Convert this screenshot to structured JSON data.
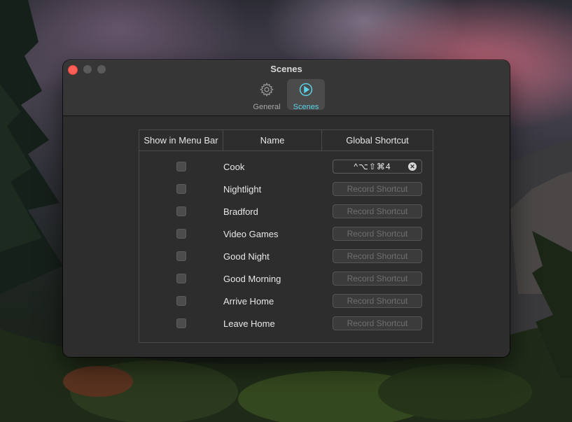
{
  "window": {
    "title": "Scenes",
    "tabs": [
      {
        "label": "General",
        "icon": "gear-icon",
        "active": false
      },
      {
        "label": "Scenes",
        "icon": "play-icon",
        "active": true
      }
    ]
  },
  "table": {
    "headers": [
      "Show in Menu Bar",
      "Name",
      "Global Shortcut"
    ],
    "rows": [
      {
        "name": "Cook",
        "shortcut": "^⌥⇧⌘4",
        "checked": false
      },
      {
        "name": "Nightlight",
        "shortcut": "Record Shortcut",
        "checked": false
      },
      {
        "name": "Bradford",
        "shortcut": "Record Shortcut",
        "checked": false
      },
      {
        "name": "Video Games",
        "shortcut": "Record Shortcut",
        "checked": false
      },
      {
        "name": "Good Night",
        "shortcut": "Record Shortcut",
        "checked": false
      },
      {
        "name": "Good Morning",
        "shortcut": "Record Shortcut",
        "checked": false
      },
      {
        "name": "Arrive Home",
        "shortcut": "Record Shortcut",
        "checked": false
      },
      {
        "name": "Leave Home",
        "shortcut": "Record Shortcut",
        "checked": false
      }
    ]
  },
  "colors": {
    "accent": "#5ad2e8",
    "close": "#fe5f57"
  }
}
